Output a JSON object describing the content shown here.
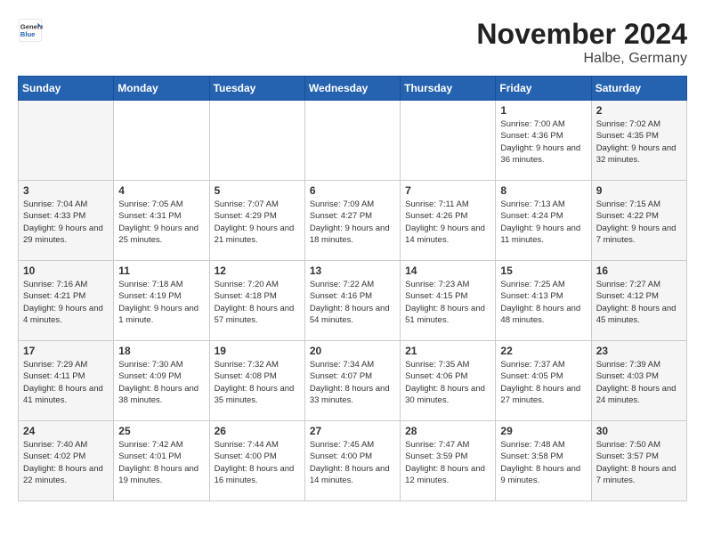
{
  "header": {
    "logo_general": "General",
    "logo_blue": "Blue",
    "month_title": "November 2024",
    "location": "Halbe, Germany"
  },
  "calendar": {
    "days_of_week": [
      "Sunday",
      "Monday",
      "Tuesday",
      "Wednesday",
      "Thursday",
      "Friday",
      "Saturday"
    ],
    "weeks": [
      [
        {
          "day": "",
          "info": ""
        },
        {
          "day": "",
          "info": ""
        },
        {
          "day": "",
          "info": ""
        },
        {
          "day": "",
          "info": ""
        },
        {
          "day": "",
          "info": ""
        },
        {
          "day": "1",
          "info": "Sunrise: 7:00 AM\nSunset: 4:36 PM\nDaylight: 9 hours and 36 minutes."
        },
        {
          "day": "2",
          "info": "Sunrise: 7:02 AM\nSunset: 4:35 PM\nDaylight: 9 hours and 32 minutes."
        }
      ],
      [
        {
          "day": "3",
          "info": "Sunrise: 7:04 AM\nSunset: 4:33 PM\nDaylight: 9 hours and 29 minutes."
        },
        {
          "day": "4",
          "info": "Sunrise: 7:05 AM\nSunset: 4:31 PM\nDaylight: 9 hours and 25 minutes."
        },
        {
          "day": "5",
          "info": "Sunrise: 7:07 AM\nSunset: 4:29 PM\nDaylight: 9 hours and 21 minutes."
        },
        {
          "day": "6",
          "info": "Sunrise: 7:09 AM\nSunset: 4:27 PM\nDaylight: 9 hours and 18 minutes."
        },
        {
          "day": "7",
          "info": "Sunrise: 7:11 AM\nSunset: 4:26 PM\nDaylight: 9 hours and 14 minutes."
        },
        {
          "day": "8",
          "info": "Sunrise: 7:13 AM\nSunset: 4:24 PM\nDaylight: 9 hours and 11 minutes."
        },
        {
          "day": "9",
          "info": "Sunrise: 7:15 AM\nSunset: 4:22 PM\nDaylight: 9 hours and 7 minutes."
        }
      ],
      [
        {
          "day": "10",
          "info": "Sunrise: 7:16 AM\nSunset: 4:21 PM\nDaylight: 9 hours and 4 minutes."
        },
        {
          "day": "11",
          "info": "Sunrise: 7:18 AM\nSunset: 4:19 PM\nDaylight: 9 hours and 1 minute."
        },
        {
          "day": "12",
          "info": "Sunrise: 7:20 AM\nSunset: 4:18 PM\nDaylight: 8 hours and 57 minutes."
        },
        {
          "day": "13",
          "info": "Sunrise: 7:22 AM\nSunset: 4:16 PM\nDaylight: 8 hours and 54 minutes."
        },
        {
          "day": "14",
          "info": "Sunrise: 7:23 AM\nSunset: 4:15 PM\nDaylight: 8 hours and 51 minutes."
        },
        {
          "day": "15",
          "info": "Sunrise: 7:25 AM\nSunset: 4:13 PM\nDaylight: 8 hours and 48 minutes."
        },
        {
          "day": "16",
          "info": "Sunrise: 7:27 AM\nSunset: 4:12 PM\nDaylight: 8 hours and 45 minutes."
        }
      ],
      [
        {
          "day": "17",
          "info": "Sunrise: 7:29 AM\nSunset: 4:11 PM\nDaylight: 8 hours and 41 minutes."
        },
        {
          "day": "18",
          "info": "Sunrise: 7:30 AM\nSunset: 4:09 PM\nDaylight: 8 hours and 38 minutes."
        },
        {
          "day": "19",
          "info": "Sunrise: 7:32 AM\nSunset: 4:08 PM\nDaylight: 8 hours and 35 minutes."
        },
        {
          "day": "20",
          "info": "Sunrise: 7:34 AM\nSunset: 4:07 PM\nDaylight: 8 hours and 33 minutes."
        },
        {
          "day": "21",
          "info": "Sunrise: 7:35 AM\nSunset: 4:06 PM\nDaylight: 8 hours and 30 minutes."
        },
        {
          "day": "22",
          "info": "Sunrise: 7:37 AM\nSunset: 4:05 PM\nDaylight: 8 hours and 27 minutes."
        },
        {
          "day": "23",
          "info": "Sunrise: 7:39 AM\nSunset: 4:03 PM\nDaylight: 8 hours and 24 minutes."
        }
      ],
      [
        {
          "day": "24",
          "info": "Sunrise: 7:40 AM\nSunset: 4:02 PM\nDaylight: 8 hours and 22 minutes."
        },
        {
          "day": "25",
          "info": "Sunrise: 7:42 AM\nSunset: 4:01 PM\nDaylight: 8 hours and 19 minutes."
        },
        {
          "day": "26",
          "info": "Sunrise: 7:44 AM\nSunset: 4:00 PM\nDaylight: 8 hours and 16 minutes."
        },
        {
          "day": "27",
          "info": "Sunrise: 7:45 AM\nSunset: 4:00 PM\nDaylight: 8 hours and 14 minutes."
        },
        {
          "day": "28",
          "info": "Sunrise: 7:47 AM\nSunset: 3:59 PM\nDaylight: 8 hours and 12 minutes."
        },
        {
          "day": "29",
          "info": "Sunrise: 7:48 AM\nSunset: 3:58 PM\nDaylight: 8 hours and 9 minutes."
        },
        {
          "day": "30",
          "info": "Sunrise: 7:50 AM\nSunset: 3:57 PM\nDaylight: 8 hours and 7 minutes."
        }
      ]
    ]
  }
}
